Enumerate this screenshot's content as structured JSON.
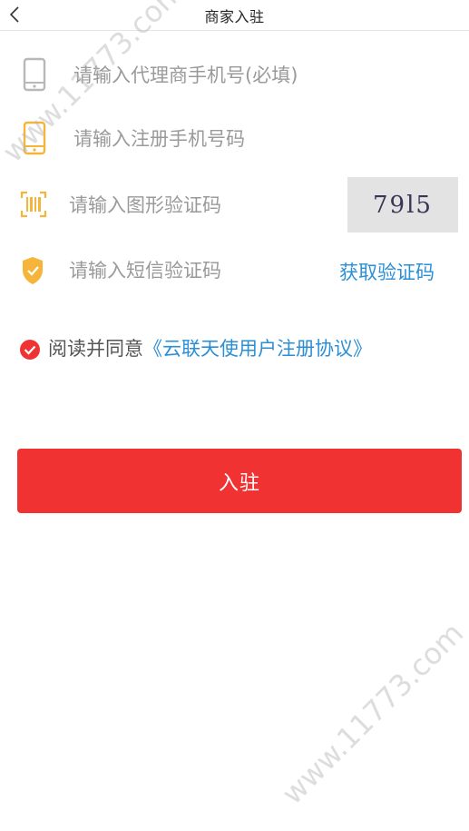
{
  "header": {
    "title": "商家入驻",
    "back_icon": "chevron-left-icon"
  },
  "form": {
    "agent_phone_placeholder": "请输入代理商手机号(必填)",
    "register_phone_placeholder": "请输入注册手机号码",
    "image_code_placeholder": "请输入图形验证码",
    "captcha_text": "79l5",
    "sms_code_placeholder": "请输入短信验证码",
    "get_code_label": "获取验证码",
    "icons": {
      "agent_phone": "phone-icon",
      "register_phone": "phone-icon",
      "image_code": "barcode-icon",
      "sms_code": "shield-check-icon"
    }
  },
  "agreement": {
    "checked": true,
    "prefix": "阅读并同意",
    "link_text": "《云联天使用户注册协议》"
  },
  "submit_label": "入驻",
  "watermark": {
    "text": "www.11773.com"
  },
  "colors": {
    "accent_red": "#f03232",
    "link_blue": "#2b8fd6",
    "icon_gray": "#b8b8b8",
    "icon_orange": "#f5b53a",
    "placeholder_gray": "#9a9a9a"
  }
}
